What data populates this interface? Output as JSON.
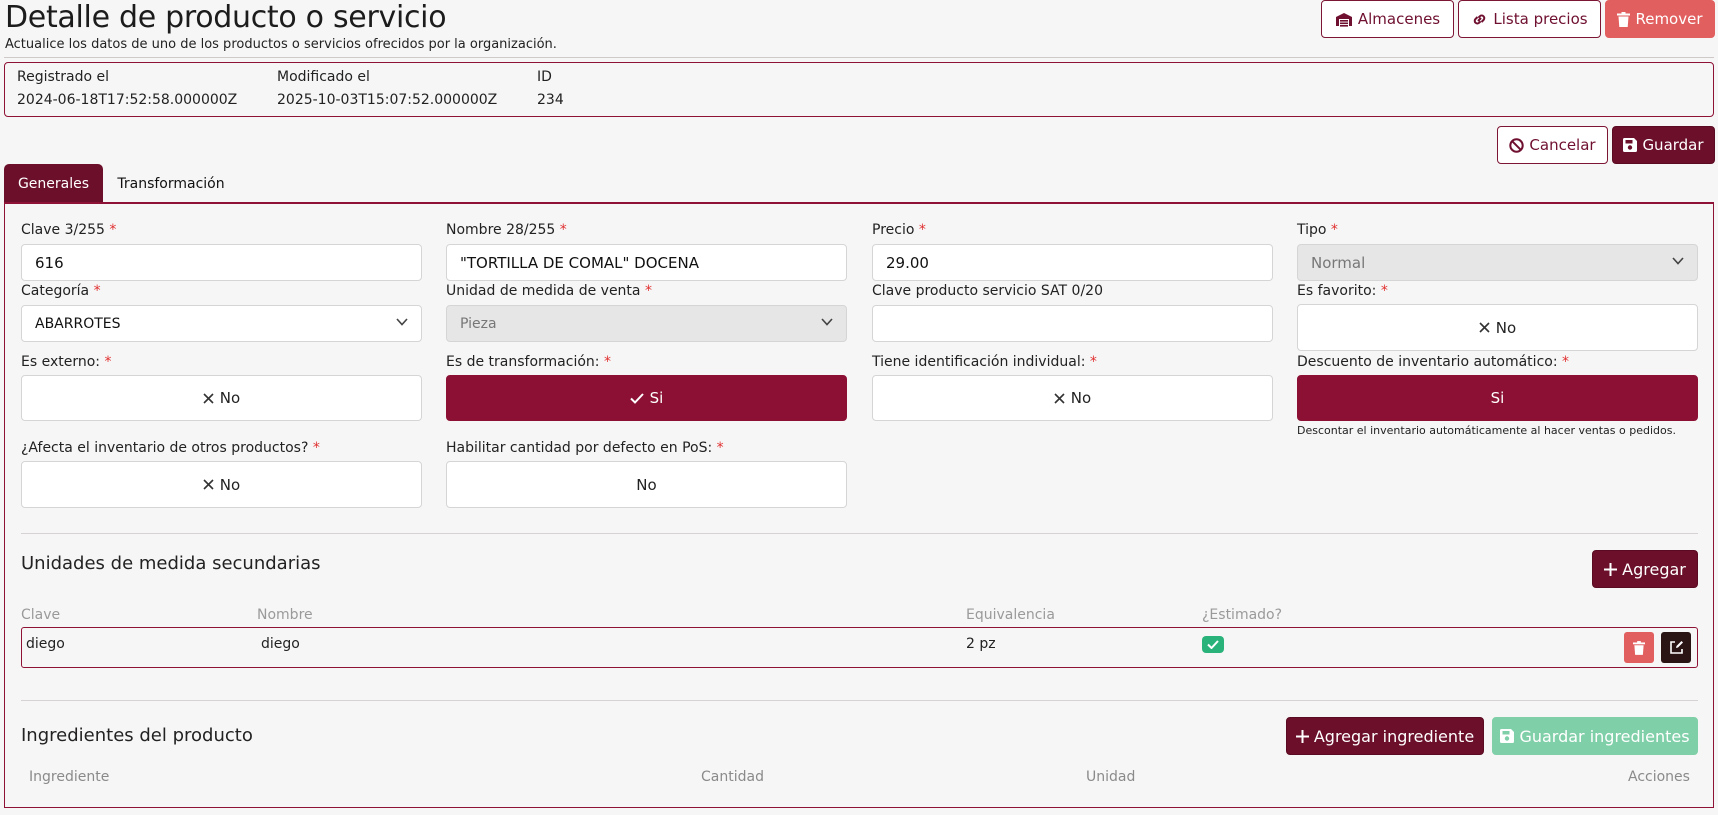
{
  "header": {
    "title": "Detalle de producto o servicio",
    "subtitle": "Actualice los datos de uno de los productos o servicios ofrecidos por la organización.",
    "almacenes_label": "Almacenes",
    "lista_precios_label": "Lista precios",
    "remover_label": "Remover"
  },
  "meta": {
    "registrado_label": "Registrado el",
    "registrado_value": "2024-06-18T17:52:58.000000Z",
    "modificado_label": "Modificado el",
    "modificado_value": "2025-10-03T15:07:52.000000Z",
    "id_label": "ID",
    "id_value": "234"
  },
  "actions": {
    "cancelar_label": "Cancelar",
    "guardar_label": "Guardar"
  },
  "tabs": [
    {
      "label": "Generales",
      "active": true
    },
    {
      "label": "Transformación",
      "active": false
    }
  ],
  "form": {
    "clave": {
      "label": "Clave 3/255",
      "value": "616"
    },
    "nombre": {
      "label": "Nombre 28/255",
      "value": "\"TORTILLA DE COMAL\" DOCENA"
    },
    "precio": {
      "label": "Precio",
      "value": "29.00"
    },
    "tipo": {
      "label": "Tipo",
      "value": "Normal"
    },
    "categoria": {
      "label": "Categoría",
      "value": "ABARROTES"
    },
    "unidad_venta": {
      "label": "Unidad de medida de venta",
      "value": "Pieza"
    },
    "clave_sat": {
      "label": "Clave producto servicio SAT 0/20",
      "value": ""
    },
    "es_favorito": {
      "label": "Es favorito:",
      "value": "No"
    },
    "es_externo": {
      "label": "Es externo:",
      "value": "No"
    },
    "es_transformacion": {
      "label": "Es de transformación:",
      "value": "Si"
    },
    "identificacion_individual": {
      "label": "Tiene identificación individual:",
      "value": "No"
    },
    "descuento_inventario": {
      "label": "Descuento de inventario automático:",
      "value": "Si",
      "help": "Descontar el inventario automáticamente al hacer ventas o pedidos."
    },
    "afecta_inventario": {
      "label": "¿Afecta el inventario de otros productos?",
      "value": "No"
    },
    "cantidad_defecto_pos": {
      "label": "Habilitar cantidad por defecto en PoS:",
      "value": "No"
    }
  },
  "units_section": {
    "title": "Unidades de medida secundarias",
    "add_label": "Agregar",
    "columns": [
      "Clave",
      "Nombre",
      "Equivalencia",
      "¿Estimado?"
    ],
    "rows": [
      {
        "clave": "diego",
        "nombre": "diego",
        "equivalencia": "2 pz",
        "estimado": true
      }
    ]
  },
  "ingredients_section": {
    "title": "Ingredientes del producto",
    "add_label": "Agregar ingrediente",
    "save_label": "Guardar ingredientes",
    "columns": [
      "Ingrediente",
      "Cantidad",
      "Unidad",
      "Acciones"
    ]
  },
  "colors": {
    "primary": "#6b0f2a",
    "toggle_on": "#8b1034",
    "danger": "#e25f5f",
    "success": "#2ab27b",
    "required": "#e03030"
  }
}
